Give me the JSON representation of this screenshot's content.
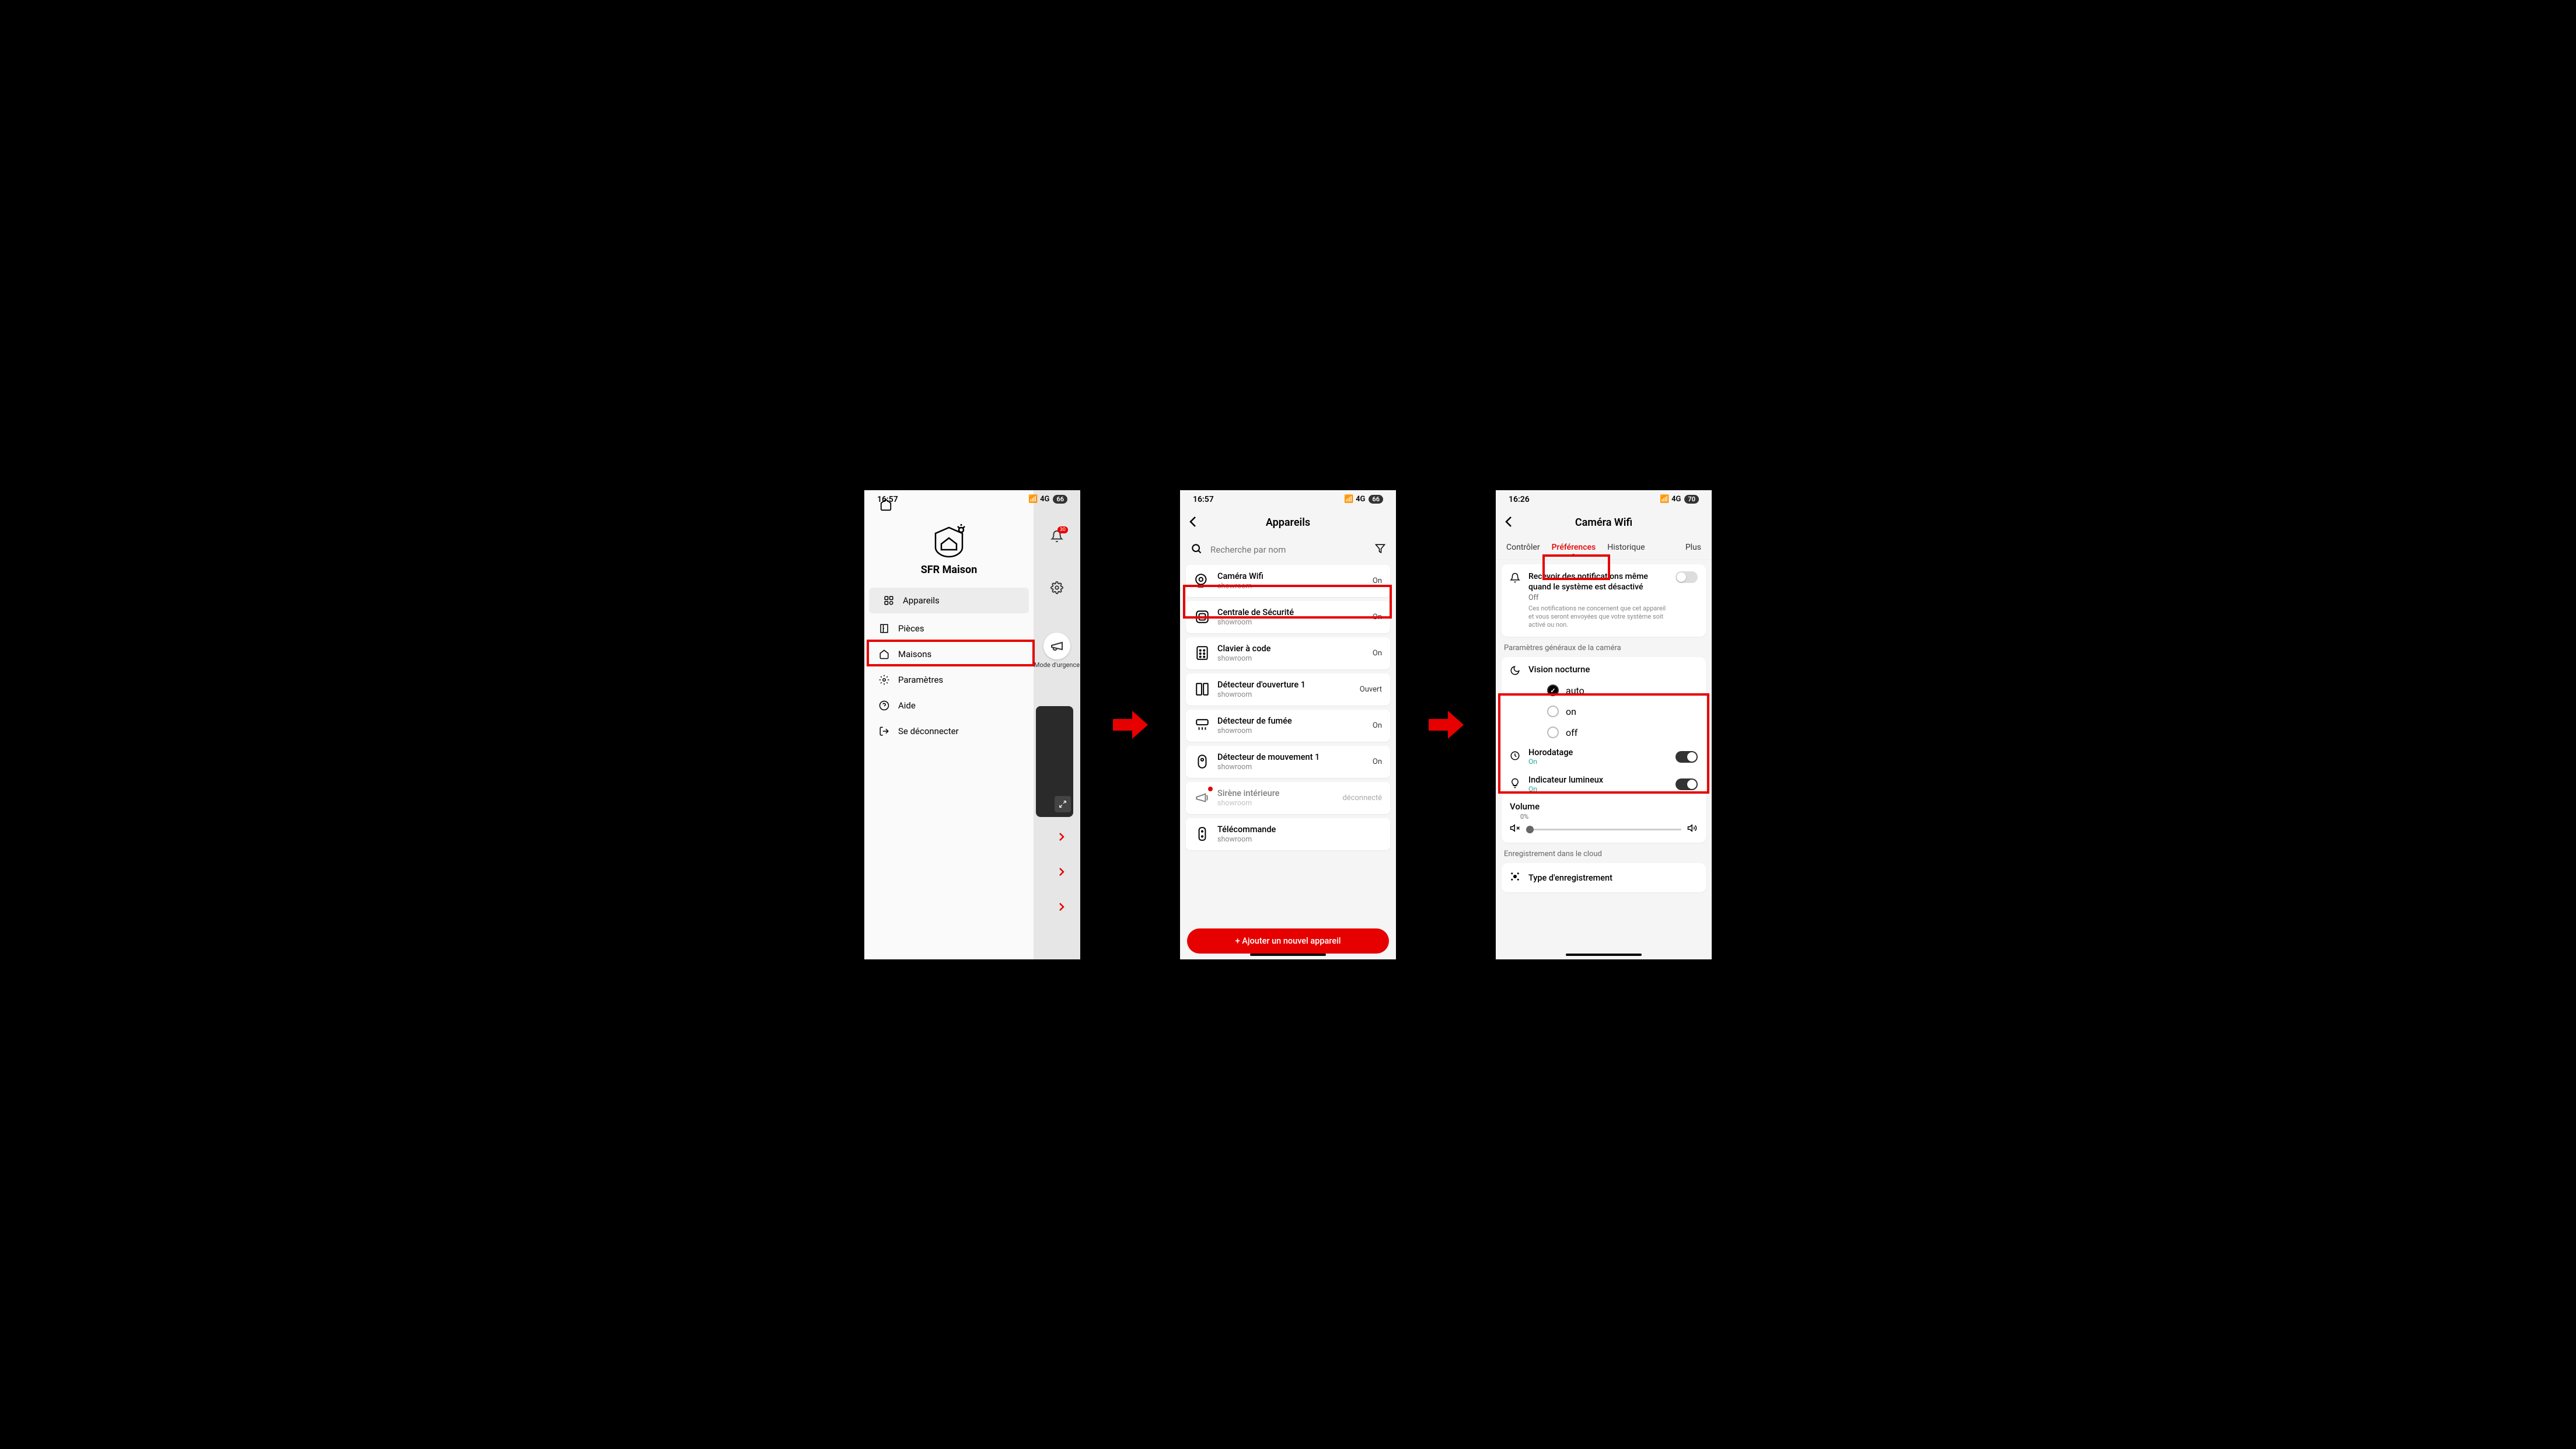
{
  "screen1": {
    "time": "16:57",
    "network": "4G",
    "battery": "66",
    "app_title": "SFR Maison",
    "notif_count": "30",
    "urgency_label": "Mode d'urgence",
    "menu": {
      "appareils": "Appareils",
      "pieces": "Pièces",
      "maisons": "Maisons",
      "parametres": "Paramètres",
      "aide": "Aide",
      "deconnecter": "Se déconnecter"
    }
  },
  "screen2": {
    "time": "16:57",
    "network": "4G",
    "battery": "66",
    "title": "Appareils",
    "search_placeholder": "Recherche par nom",
    "add_button": "+ Ajouter un nouvel appareil",
    "devices": [
      {
        "name": "Caméra Wifi",
        "room": "showroom",
        "status": "On"
      },
      {
        "name": "Centrale de Sécurité",
        "room": "showroom",
        "status": "On"
      },
      {
        "name": "Clavier à code",
        "room": "showroom",
        "status": "On"
      },
      {
        "name": "Détecteur d'ouverture 1",
        "room": "showroom",
        "status": "Ouvert"
      },
      {
        "name": "Détecteur de fumée",
        "room": "showroom",
        "status": "On"
      },
      {
        "name": "Détecteur de mouvement 1",
        "room": "showroom",
        "status": "On"
      },
      {
        "name": "Sirène intérieure",
        "room": "showroom",
        "status": "déconnecté"
      },
      {
        "name": "Télécommande",
        "room": "showroom",
        "status": ""
      }
    ]
  },
  "screen3": {
    "time": "16:26",
    "network": "4G",
    "battery": "70",
    "title": "Caméra Wifi",
    "tabs": {
      "controler": "Contrôler",
      "preferences": "Préférences",
      "historique": "Historique",
      "plus": "Plus"
    },
    "notif": {
      "title": "Recevoir des notifications même quand le système est désactivé",
      "state": "Off",
      "desc": "Ces notifications ne concernent que cet appareil et vous seront envoyées que votre système soit activé ou non."
    },
    "section_general": "Paramètres généraux de la caméra",
    "night_vision": {
      "title": "Vision nocturne",
      "auto": "auto",
      "on": "on",
      "off": "off"
    },
    "horodatage": {
      "title": "Horodatage",
      "state": "On"
    },
    "indicateur": {
      "title": "Indicateur lumineux",
      "state": "On"
    },
    "volume": {
      "title": "Volume",
      "pct": "0%"
    },
    "section_cloud": "Enregistrement dans le cloud",
    "rec_type": "Type d'enregistrement"
  }
}
